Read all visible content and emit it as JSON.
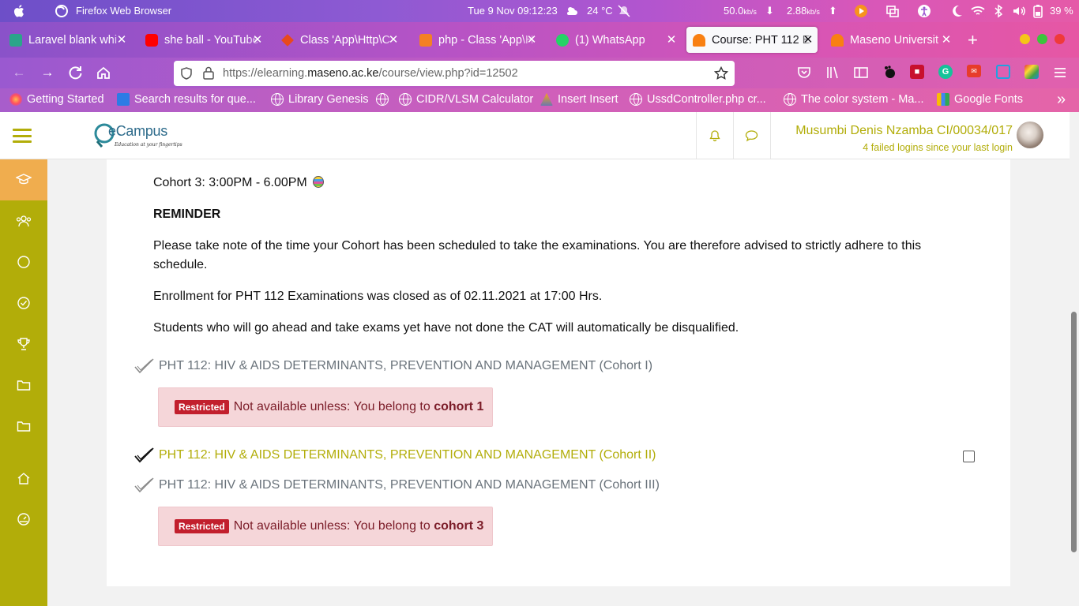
{
  "system_bar": {
    "app_name": "Firefox Web Browser",
    "date_time": "Tue 9 Nov  09:12:23",
    "weather": "24 °C",
    "net_down": "50.0",
    "net_down_unit": "kb/s",
    "net_up": "2.88",
    "net_up_unit": "kb/s",
    "battery": "39 %"
  },
  "tabs": [
    {
      "title": "Laravel blank whi",
      "favicon_color": "#2ba58a",
      "active": false
    },
    {
      "title": "she ball - YouTube",
      "favicon_color": "#ff0000",
      "active": false
    },
    {
      "title": "Class 'App\\Http\\C",
      "favicon_color": "#e8491d",
      "active": false
    },
    {
      "title": "php - Class 'App\\H",
      "favicon_color": "#f48024",
      "active": false
    },
    {
      "title": "(1) WhatsApp",
      "favicon_color": "#25d366",
      "active": false
    },
    {
      "title": "Course: PHT 112 E",
      "favicon_color": "#f98012",
      "active": true
    },
    {
      "title": "Maseno Universit",
      "favicon_color": "#f98012",
      "active": false
    }
  ],
  "new_tab_label": "+",
  "url": {
    "prefix": "https://elearning.",
    "domain": "maseno.ac.ke",
    "path": "/course/view.php?id=12502"
  },
  "bookmarks": [
    {
      "label": "Getting Started",
      "icon": "firefox-icon"
    },
    {
      "label": "Search results for que...",
      "icon": "search-results-icon"
    },
    {
      "label": "Library Genesis",
      "icon": "globe-icon"
    },
    {
      "label": "",
      "icon": "globe-icon"
    },
    {
      "label": "CIDR/VLSM Calculator",
      "icon": "globe-icon"
    },
    {
      "label": "Insert Insert",
      "icon": "pma-icon"
    },
    {
      "label": "UssdController.php cr...",
      "icon": "globe-icon"
    },
    {
      "label": "The color system - Ma...",
      "icon": "globe-icon"
    },
    {
      "label": "Google Fonts",
      "icon": "google-fonts-icon"
    }
  ],
  "header": {
    "logo_text": "eCampus",
    "logo_tagline": "Education at your fingertips",
    "user_name": "Musumbi Denis Nzamba CI/00034/017",
    "failed_logins": "4 failed logins since your last login"
  },
  "content": {
    "cohort3": "Cohort 3: 3:00PM  - 6.00PM",
    "reminder": "REMINDER",
    "note": "Please take note of the time your Cohort has been scheduled to take the examinations.  You are therefore advised to strictly adhere to this schedule.",
    "enrollment": "Enrollment for PHT 112 Examinations was closed as of 02.11.2021 at 17:00 Hrs.",
    "students": "Students who will go ahead and take exams yet have not done the CAT will automatically be disqualified.",
    "activities": [
      {
        "title": "PHT 112: HIV & AIDS DETERMINANTS, PREVENTION AND MANAGEMENT (Cohort I)",
        "available": false,
        "restriction_badge": "Restricted",
        "restriction_text": "Not available unless: You belong to ",
        "restriction_group": "cohort 1"
      },
      {
        "title": "PHT 112: HIV & AIDS DETERMINANTS, PREVENTION AND MANAGEMENT (Cohort II)",
        "available": true
      },
      {
        "title": "PHT 112: HIV & AIDS DETERMINANTS, PREVENTION AND MANAGEMENT (Cohort III)",
        "available": false,
        "restriction_badge": "Restricted",
        "restriction_text": "Not available unless: You belong to ",
        "restriction_group": "cohort 3"
      }
    ]
  },
  "colors": {
    "theme": "#b2ad09",
    "active_nav": "#f0ad4e",
    "restricted_bg": "#f5d6d9",
    "restricted_badge": "#c21f2d"
  }
}
